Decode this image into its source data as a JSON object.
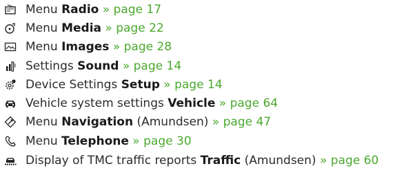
{
  "colors": {
    "text": "#2b2b2b",
    "link": "#4ba82e"
  },
  "items": [
    {
      "icon": "radio-icon",
      "prefix": "Menu ",
      "bold": "Radio",
      "suffix": "",
      "link": " » page 17"
    },
    {
      "icon": "media-icon",
      "prefix": "Menu ",
      "bold": "Media",
      "suffix": "",
      "link": " » page 22"
    },
    {
      "icon": "images-icon",
      "prefix": "Menu ",
      "bold": "Images",
      "suffix": "",
      "link": " » page 28"
    },
    {
      "icon": "sound-icon",
      "prefix": "Settings ",
      "bold": "Sound",
      "suffix": "",
      "link": " » page 14"
    },
    {
      "icon": "setup-gear-icon",
      "prefix": "Device Settings ",
      "bold": "Setup",
      "suffix": "",
      "link": " » page 14"
    },
    {
      "icon": "vehicle-icon",
      "prefix": "Vehicle system settings ",
      "bold": "Vehicle",
      "suffix": "",
      "link": " » page 64"
    },
    {
      "icon": "navigation-icon",
      "prefix": "Menu ",
      "bold": "Navigation",
      "suffix": " (Amundsen)",
      "link": " » page 47"
    },
    {
      "icon": "telephone-icon",
      "prefix": "Menu ",
      "bold": "Telephone",
      "suffix": "",
      "link": " » page 30"
    },
    {
      "icon": "traffic-icon",
      "prefix": "Display of TMC traffic reports ",
      "bold": "Traffic",
      "suffix": " (Amundsen)",
      "link": " » page 60"
    }
  ]
}
